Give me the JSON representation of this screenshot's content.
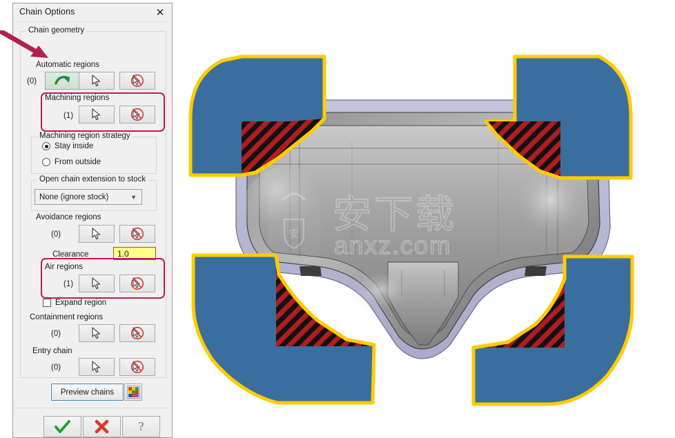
{
  "dialog": {
    "title": "Chain Options",
    "close_icon": "close-icon",
    "groups": {
      "chain_geometry": {
        "caption": "Chain geometry"
      },
      "automatic_regions": {
        "label": "Automatic regions",
        "count": "(0)"
      },
      "machining_regions": {
        "label": "Machining regions",
        "count": "(1)"
      },
      "machining_region_strategy": {
        "caption": "Machining region strategy",
        "options": [
          {
            "label": "Stay inside",
            "selected": true
          },
          {
            "label": "From outside",
            "selected": false
          }
        ]
      },
      "open_chain_extension": {
        "caption": "Open chain extension to stock",
        "value": "None (ignore stock)"
      },
      "avoidance_regions": {
        "label": "Avoidance regions",
        "count": "(0)"
      },
      "clearance": {
        "label": "Clearance",
        "value": "1.0"
      },
      "air_regions": {
        "label": "Air regions",
        "count": "(1)"
      },
      "expand_region": {
        "label": "Expand region",
        "checked": false
      },
      "containment_regions": {
        "label": "Containment regions",
        "count": "(0)"
      },
      "entry_chain": {
        "label": "Entry chain",
        "count": "(0)"
      }
    },
    "buttons": {
      "auto_generate_icon": "green-curved-arrow-icon",
      "pick_icon": "cursor-pick-icon",
      "unpick_icon": "cursor-unpick-icon",
      "preview_chains": "Preview chains",
      "color_grid_icon": "color-grid-icon",
      "ok_icon": "green-check-icon",
      "cancel_icon": "red-x-icon",
      "help_icon": "question-mark-icon"
    }
  },
  "annotation": {
    "arrow_color": "#b02050",
    "highlight_color": "#c2185b"
  },
  "viewport": {
    "watermark_text_cn": "安下载",
    "watermark_text_en": "anxz.com",
    "colors": {
      "stock_blue": "#3a6e9e",
      "chain_yellow": "#ffcc00",
      "machining_red": "#b01c20",
      "hatch_black": "#101010",
      "part_gray": "#9a9a9a",
      "part_lavender": "#b5b6d2"
    }
  }
}
